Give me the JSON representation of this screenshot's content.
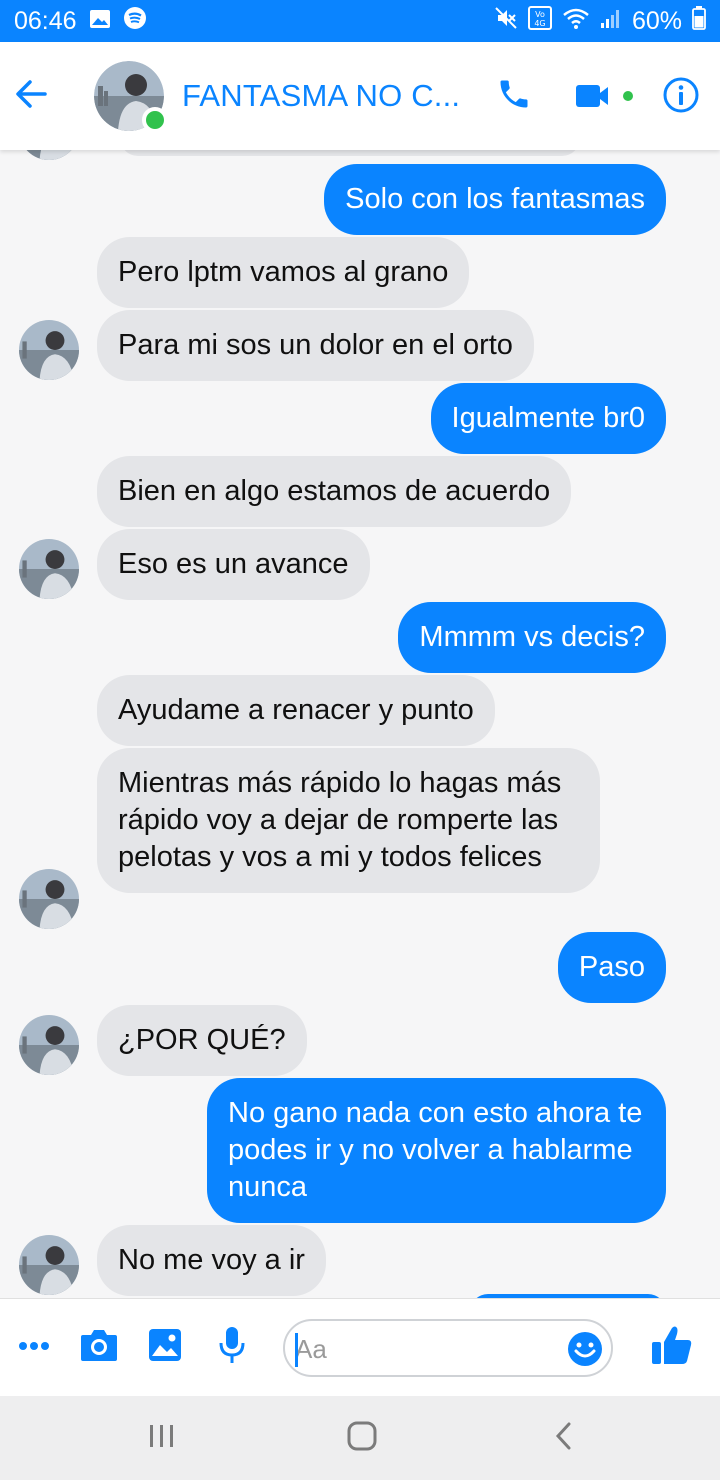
{
  "status_bar": {
    "time": "06:46",
    "battery": "60%",
    "icons": [
      "gallery-icon",
      "spotify-icon",
      "mute-icon",
      "volte-icon",
      "wifi-icon",
      "signal-icon",
      "battery-icon"
    ]
  },
  "header": {
    "title": "FANTASMA NO C...",
    "online": true,
    "icons": [
      "back-arrow-icon",
      "phone-icon",
      "video-camera-icon",
      "info-icon"
    ]
  },
  "messages": [
    {
      "dir": "out",
      "text": "Solo con los fantasmas"
    },
    {
      "dir": "in",
      "text": "Pero lptm vamos al grano"
    },
    {
      "dir": "in",
      "text": "Para mi sos un dolor en el orto"
    },
    {
      "dir": "out",
      "text": "Igualmente br0"
    },
    {
      "dir": "in",
      "text": "Bien en algo estamos de acuerdo"
    },
    {
      "dir": "in",
      "text": "Eso es un avance"
    },
    {
      "dir": "out",
      "text": "Mmmm vs decis?"
    },
    {
      "dir": "in",
      "text": "Ayudame a renacer y punto"
    },
    {
      "dir": "in",
      "text": "Mientras más rápido lo hagas más rápido voy a dejar de romperte las pelotas y vos a mi y todos felices"
    },
    {
      "dir": "out",
      "text": "Paso"
    },
    {
      "dir": "in",
      "text": "¿POR QUÉ?"
    },
    {
      "dir": "out",
      "text": "No gano nada con esto ahora te podes ir y no volver a hablarme nunca"
    },
    {
      "dir": "in",
      "text": "No me voy a ir"
    }
  ],
  "composer": {
    "placeholder": "Aa",
    "icons": [
      "more-icon",
      "camera-icon",
      "image-icon",
      "microphone-icon",
      "emoji-icon",
      "thumbs-up-icon"
    ]
  },
  "colors": {
    "accent": "#0a84ff",
    "incoming_bubble": "#e4e5e8",
    "online": "#31c24d"
  }
}
